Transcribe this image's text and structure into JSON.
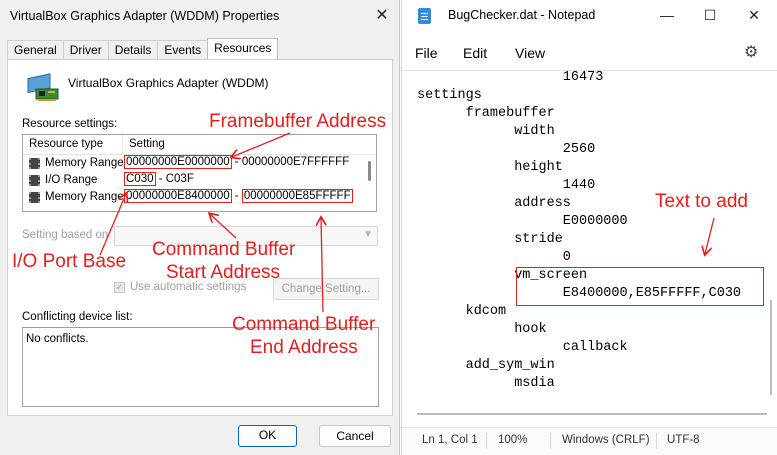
{
  "dialog": {
    "title": "VirtualBox Graphics Adapter (WDDM) Properties",
    "tabs": [
      "General",
      "Driver",
      "Details",
      "Events",
      "Resources"
    ],
    "active_tab": "Resources",
    "device_name": "VirtualBox Graphics Adapter (WDDM)",
    "resource_settings_label": "Resource settings:",
    "columns": [
      "Resource type",
      "Setting"
    ],
    "rows": [
      {
        "type": "Memory Range",
        "start": "00000000E0000000",
        "sep": " - ",
        "end": "00000000E7FFFFFF"
      },
      {
        "type": "I/O Range",
        "start": "C030",
        "sep": " - ",
        "end": "C03F"
      },
      {
        "type": "Memory Range",
        "start": "00000000E8400000",
        "sep": " - ",
        "end": "00000000E85FFFFF"
      }
    ],
    "setting_based_on_label": "Setting based on:",
    "use_automatic_label": "Use automatic settings",
    "change_setting_label": "Change Setting...",
    "conflicting_label": "Conflicting device list:",
    "conflicting_text": "No conflicts.",
    "ok_label": "OK",
    "cancel_label": "Cancel"
  },
  "annotations": {
    "framebuffer": "Framebuffer Address",
    "io_port_base": "I/O Port Base",
    "cmd_start_1": "Command Buffer",
    "cmd_start_2": "Start Address",
    "cmd_end_1": "Command Buffer",
    "cmd_end_2": "End Address",
    "text_to_add": "Text to add",
    "color": "#e02020"
  },
  "notepad": {
    "title": "BugChecker.dat - Notepad",
    "menu": [
      "File",
      "Edit",
      "View"
    ],
    "lines": [
      {
        "indent": 6,
        "text": "16473"
      },
      {
        "indent": 0,
        "text": "settings"
      },
      {
        "indent": 2,
        "text": "framebuffer"
      },
      {
        "indent": 4,
        "text": "width"
      },
      {
        "indent": 6,
        "text": "2560"
      },
      {
        "indent": 4,
        "text": "height"
      },
      {
        "indent": 6,
        "text": "1440"
      },
      {
        "indent": 4,
        "text": "address"
      },
      {
        "indent": 6,
        "text": "E0000000"
      },
      {
        "indent": 4,
        "text": "stride"
      },
      {
        "indent": 6,
        "text": "0"
      },
      {
        "indent": 4,
        "text": "vm_screen"
      },
      {
        "indent": 6,
        "text": "E8400000,E85FFFFF,C030"
      },
      {
        "indent": 2,
        "text": "kdcom"
      },
      {
        "indent": 4,
        "text": "hook"
      },
      {
        "indent": 6,
        "text": "callback"
      },
      {
        "indent": 2,
        "text": "add_sym_win"
      },
      {
        "indent": 4,
        "text": "msdia"
      }
    ],
    "status": {
      "position": "Ln 1, Col 1",
      "zoom": "100%",
      "line_ending": "Windows (CRLF)",
      "encoding": "UTF-8"
    }
  },
  "icons": [
    "close-icon",
    "monitor-card-icon",
    "chip-icon",
    "chevron-down-icon",
    "minimize-icon",
    "maximize-icon",
    "gear-icon",
    "notepad-icon"
  ]
}
